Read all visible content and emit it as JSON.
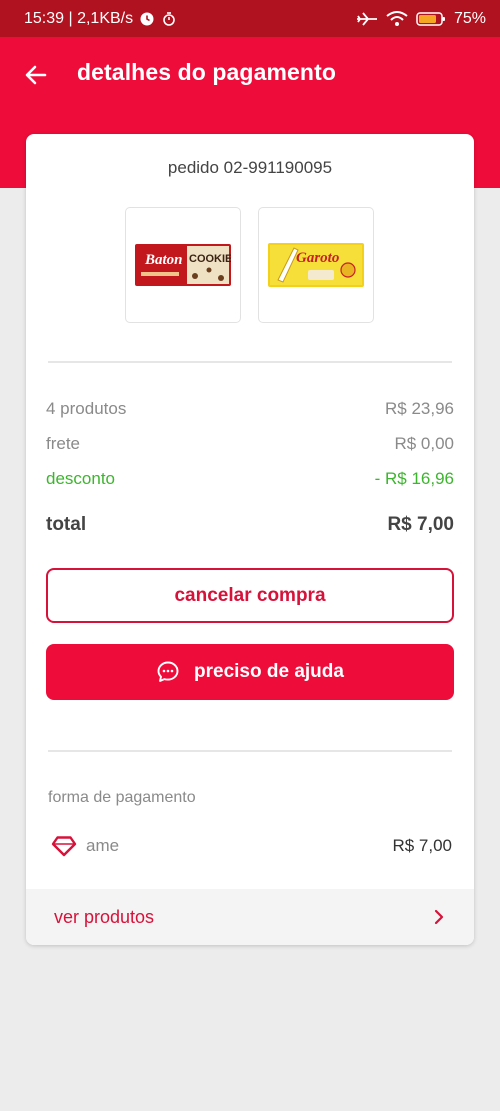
{
  "status_bar": {
    "time_speed": "15:39 | 2,1KB/s",
    "battery": "75%"
  },
  "header": {
    "title": "detalhes do pagamento",
    "back_icon": "arrow-left-icon"
  },
  "order": {
    "id_label": "pedido 02-991190095",
    "products": [
      {
        "name": "Baton Cookie"
      },
      {
        "name": "Garoto"
      }
    ]
  },
  "summary": {
    "products_label": "4 produtos",
    "products_value": "R$ 23,96",
    "shipping_label": "frete",
    "shipping_value": "R$ 0,00",
    "discount_label": "desconto",
    "discount_value": "- R$ 16,96",
    "total_label": "total",
    "total_value": "R$ 7,00"
  },
  "actions": {
    "cancel_label": "cancelar compra",
    "help_label": "preciso de ajuda"
  },
  "payment": {
    "section_label": "forma de pagamento",
    "method": "ame",
    "amount": "R$ 7,00"
  },
  "footer": {
    "view_products_label": "ver produtos"
  },
  "colors": {
    "brand": "#ee0c3a",
    "status_bar": "#b0121f",
    "discount_green": "#3eb52f"
  }
}
